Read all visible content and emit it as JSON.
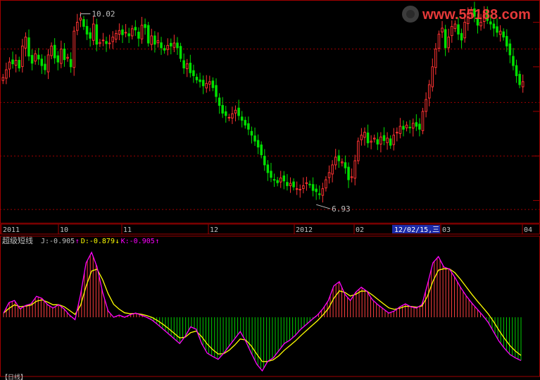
{
  "chart_data": [
    {
      "type": "candlestick",
      "title": "",
      "x_axis_labels": [
        "2011",
        "10",
        "11",
        "12",
        "2012",
        "02",
        "03",
        "04"
      ],
      "highlight_label": "12/02/15,三",
      "price_high_label": "10.02",
      "price_low_label": "6.93",
      "ylim": [
        6.6,
        10.3
      ],
      "gridlines": [
        9.5,
        8.6,
        7.7,
        6.8
      ],
      "colors": {
        "up": "#ff3232",
        "down": "#00e000",
        "grid": "#a00000",
        "axis": "#c0c0c0"
      },
      "closes": [
        9.02,
        9.15,
        9.28,
        9.25,
        9.31,
        9.18,
        9.55,
        9.7,
        9.38,
        9.26,
        9.42,
        9.33,
        9.22,
        9.15,
        9.4,
        9.55,
        9.35,
        9.28,
        9.5,
        9.32,
        9.36,
        9.2,
        9.8,
        9.95,
        10.02,
        9.88,
        9.75,
        9.68,
        9.92,
        9.58,
        9.61,
        9.65,
        9.59,
        9.6,
        9.7,
        9.76,
        9.81,
        9.74,
        9.78,
        9.72,
        9.84,
        9.82,
        9.68,
        9.9,
        9.86,
        9.6,
        9.72,
        9.58,
        9.64,
        9.52,
        9.48,
        9.56,
        9.55,
        9.6,
        9.52,
        9.34,
        9.18,
        9.25,
        9.1,
        9.05,
        8.98,
        8.95,
        8.88,
        8.92,
        8.95,
        8.85,
        8.7,
        8.55,
        8.42,
        8.38,
        8.35,
        8.41,
        8.47,
        8.38,
        8.3,
        8.22,
        8.15,
        8.05,
        7.95,
        7.85,
        7.72,
        7.55,
        7.42,
        7.34,
        7.3,
        7.25,
        7.33,
        7.28,
        7.2,
        7.24,
        7.18,
        7.15,
        7.14,
        7.2,
        7.25,
        7.22,
        7.12,
        7.1,
        7.05,
        7.15,
        7.3,
        7.42,
        7.55,
        7.68,
        7.62,
        7.6,
        7.5,
        7.3,
        7.35,
        7.62,
        7.95,
        8.05,
        8.1,
        7.92,
        7.95,
        8.0,
        7.9,
        8.02,
        7.96,
        8.0,
        7.88,
        8.05,
        8.1,
        8.2,
        8.15,
        8.22,
        8.18,
        8.25,
        8.2,
        8.15,
        8.45,
        8.65,
        8.9,
        9.2,
        9.5,
        9.75,
        9.85,
        9.52,
        9.7,
        9.88,
        9.92,
        9.75,
        9.65,
        9.95,
        10.1,
        10.15,
        10.05,
        9.9,
        9.95,
        10.12,
        9.98,
        9.92,
        9.85,
        9.78,
        9.8,
        9.7,
        9.55,
        9.4,
        9.22,
        9.05,
        8.9,
        8.95
      ],
      "series": [
        {
          "name": "J",
          "value_label": "J:-0.905",
          "arrow": "↑",
          "color": "#ff00ff"
        },
        {
          "name": "D",
          "value_label": "D:-0.879",
          "arrow": "↓",
          "color": "#ffff00"
        },
        {
          "name": "K",
          "value_label": "K:-0.905",
          "arrow": "↑",
          "color": "#ff00ff"
        }
      ],
      "kdj_values": [
        0.1,
        0.35,
        0.4,
        0.2,
        0.28,
        0.32,
        0.5,
        0.45,
        0.3,
        0.22,
        0.3,
        0.2,
        0.05,
        -0.05,
        0.55,
        1.3,
        1.55,
        1.2,
        0.6,
        0.15,
        0.0,
        0.05,
        0.0,
        0.06,
        0.1,
        0.05,
        0.0,
        -0.06,
        -0.15,
        -0.25,
        -0.35,
        -0.45,
        -0.55,
        -0.4,
        -0.2,
        -0.25,
        -0.55,
        -0.75,
        -0.82,
        -0.88,
        -0.75,
        -0.6,
        -0.45,
        -0.3,
        -0.5,
        -0.75,
        -0.98,
        -1.12,
        -0.92,
        -0.85,
        -0.7,
        -0.55,
        -0.48,
        -0.38,
        -0.25,
        -0.15,
        -0.05,
        0.05,
        0.2,
        0.4,
        0.75,
        0.85,
        0.55,
        0.4,
        0.6,
        0.72,
        0.62,
        0.42,
        0.3,
        0.2,
        0.1,
        0.15,
        0.25,
        0.32,
        0.25,
        0.22,
        0.3,
        0.78,
        1.3,
        1.45,
        1.2,
        1.15,
        0.95,
        0.72,
        0.52,
        0.35,
        0.2,
        0.05,
        -0.1,
        -0.3,
        -0.5,
        -0.65,
        -0.78,
        -0.85,
        -0.905
      ],
      "subtitle": "超级短线",
      "watermark": "www.55188.com",
      "bottom_tab": "【日线】"
    }
  ]
}
